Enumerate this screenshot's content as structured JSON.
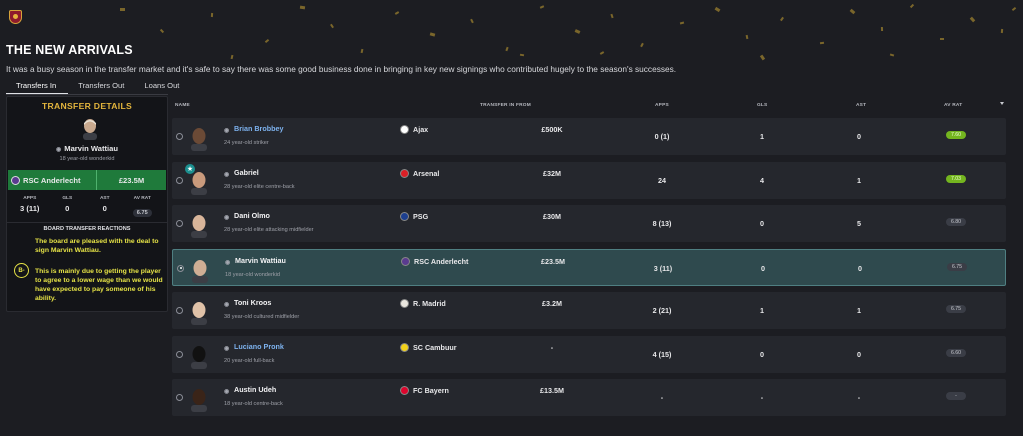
{
  "page": {
    "title": "THE NEW ARRIVALS",
    "subtitle": "It was a busy season in the transfer market and it's safe to say there was some good business done in bringing in key new signings who contributed hugely to the season's successes."
  },
  "tabs": [
    {
      "label": "Transfers In",
      "active": true
    },
    {
      "label": "Transfers Out",
      "active": false
    },
    {
      "label": "Loans Out",
      "active": false
    }
  ],
  "details": {
    "heading": "TRANSFER DETAILS",
    "player_name": "Marvin Wattiau",
    "player_desc": "18 year-old wonderkid",
    "club": "RSC Anderlecht",
    "fee": "£23.5M",
    "stats": [
      {
        "label": "APPS",
        "value": "3 (11)"
      },
      {
        "label": "GLS",
        "value": "0"
      },
      {
        "label": "AST",
        "value": "0"
      },
      {
        "label": "AV RAT",
        "value": "6.75"
      }
    ],
    "reactions_heading": "BOARD TRANSFER REACTIONS",
    "reaction_1": "The board are pleased with the deal to sign Marvin Wattiau.",
    "grade": "B-",
    "reaction_2": "This is mainly due to getting the player to agree to a lower wage than we would have expected to pay someone of his ability."
  },
  "table": {
    "headers": {
      "name": "NAME",
      "from": "TRANSFER IN FROM",
      "apps": "APPS",
      "gls": "GLS",
      "ast": "AST",
      "rat": "AV RAT"
    },
    "rows": [
      {
        "name": "Brian Brobbey",
        "desc": "24 year-old striker",
        "from": "Ajax",
        "fee": "£500K",
        "apps": "0 (1)",
        "gls": "1",
        "ast": "0",
        "rat": "7.60",
        "rat_green": true,
        "blue": true,
        "star": false,
        "selected": false,
        "badge": "#ffffff"
      },
      {
        "name": "Gabriel",
        "desc": "28 year-old elite centre-back",
        "from": "Arsenal",
        "fee": "£32M",
        "apps": "24",
        "gls": "4",
        "ast": "1",
        "rat": "7.03",
        "rat_green": true,
        "blue": false,
        "star": true,
        "selected": false,
        "badge": "#db1f26"
      },
      {
        "name": "Dani Olmo",
        "desc": "28 year-old elite attacking midfielder",
        "from": "PSG",
        "fee": "£30M",
        "apps": "8 (13)",
        "gls": "0",
        "ast": "5",
        "rat": "6.80",
        "rat_green": false,
        "blue": false,
        "star": false,
        "selected": false,
        "badge": "#1d3f8f"
      },
      {
        "name": "Marvin Wattiau",
        "desc": "18 year-old wonderkid",
        "from": "RSC Anderlecht",
        "fee": "£23.5M",
        "apps": "3 (11)",
        "gls": "0",
        "ast": "0",
        "rat": "6.75",
        "rat_green": false,
        "blue": false,
        "star": false,
        "selected": true,
        "badge": "#5a3b8f"
      },
      {
        "name": "Toni Kroos",
        "desc": "38 year-old cultured midfielder",
        "from": "R. Madrid",
        "fee": "£3.2M",
        "apps": "2 (21)",
        "gls": "1",
        "ast": "1",
        "rat": "6.75",
        "rat_green": false,
        "blue": false,
        "star": false,
        "selected": false,
        "badge": "#e9e6de"
      },
      {
        "name": "Luciano Pronk",
        "desc": "20 year-old full-back",
        "from": "SC Cambuur",
        "fee": "-",
        "apps": "4 (15)",
        "gls": "0",
        "ast": "0",
        "rat": "6.60",
        "rat_green": false,
        "blue": true,
        "star": false,
        "selected": false,
        "badge": "#f2d21b"
      },
      {
        "name": "Austin Udeh",
        "desc": "18 year-old centre-back",
        "from": "FC Bayern",
        "fee": "£13.5M",
        "apps": "-",
        "gls": "-",
        "ast": "-",
        "rat": "-",
        "rat_green": false,
        "blue": false,
        "star": false,
        "selected": false,
        "badge": "#dc052d"
      }
    ]
  },
  "colors": {
    "accent_gold": "#e3b53d",
    "reaction_yellow": "#e5e246",
    "fee_green": "#1f7a3b",
    "rating_green": "#74b51f",
    "selected_row": "#2f4a4e"
  }
}
